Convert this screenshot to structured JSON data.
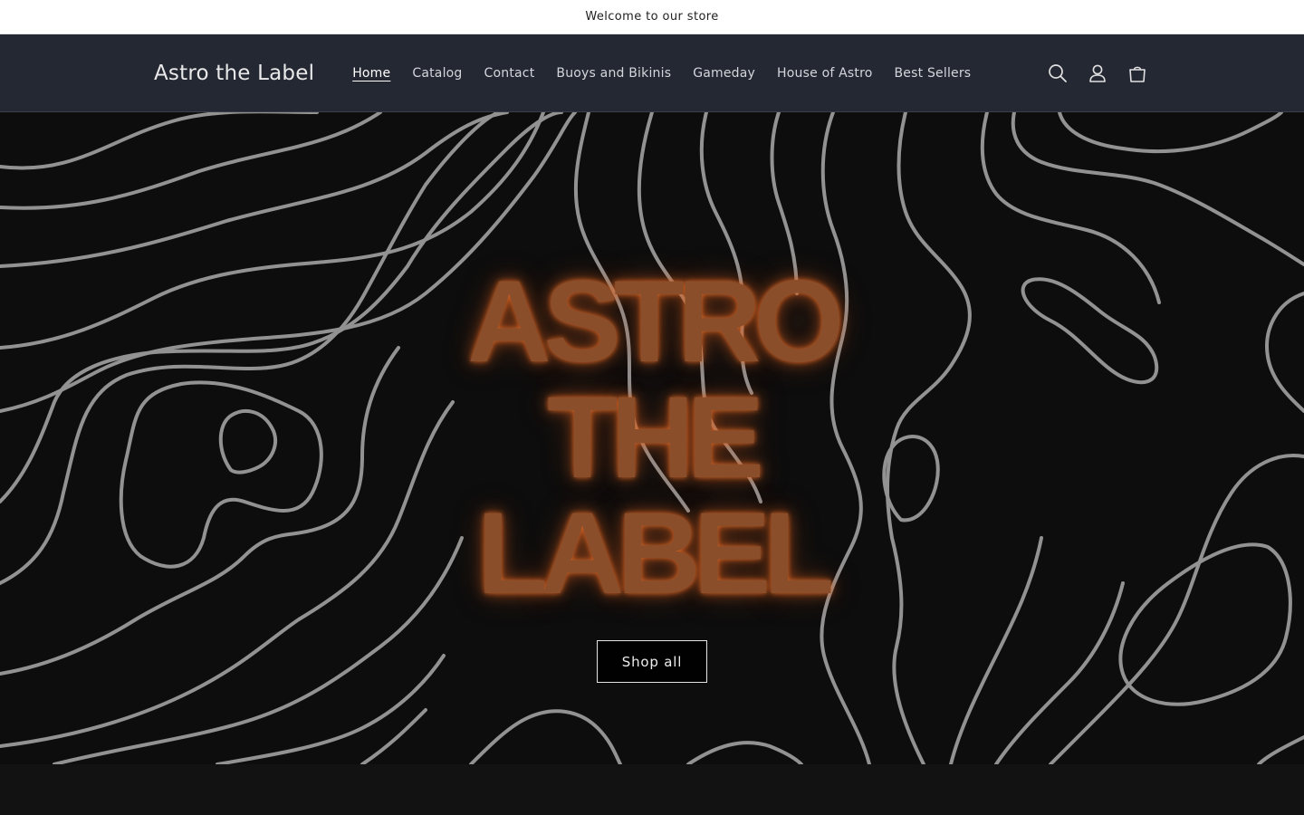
{
  "announcement": {
    "text": "Welcome to our store"
  },
  "header": {
    "logo": "Astro the Label",
    "nav": [
      {
        "label": "Home",
        "active": true
      },
      {
        "label": "Catalog",
        "active": false
      },
      {
        "label": "Contact",
        "active": false
      },
      {
        "label": "Buoys and Bikinis",
        "active": false
      },
      {
        "label": "Gameday",
        "active": false
      },
      {
        "label": "House of Astro",
        "active": false
      },
      {
        "label": "Best Sellers",
        "active": false
      }
    ],
    "icons": [
      "search-icon",
      "account-icon",
      "cart-icon"
    ]
  },
  "hero": {
    "title_lines": [
      "ASTRO",
      "THE",
      "LABEL"
    ],
    "button_label": "Shop all"
  },
  "colors": {
    "header_bg": "#242833",
    "hero_bg": "#0d0d0d",
    "neon_orange": "#d66a2c",
    "contour_line": "#9a9a9a"
  }
}
